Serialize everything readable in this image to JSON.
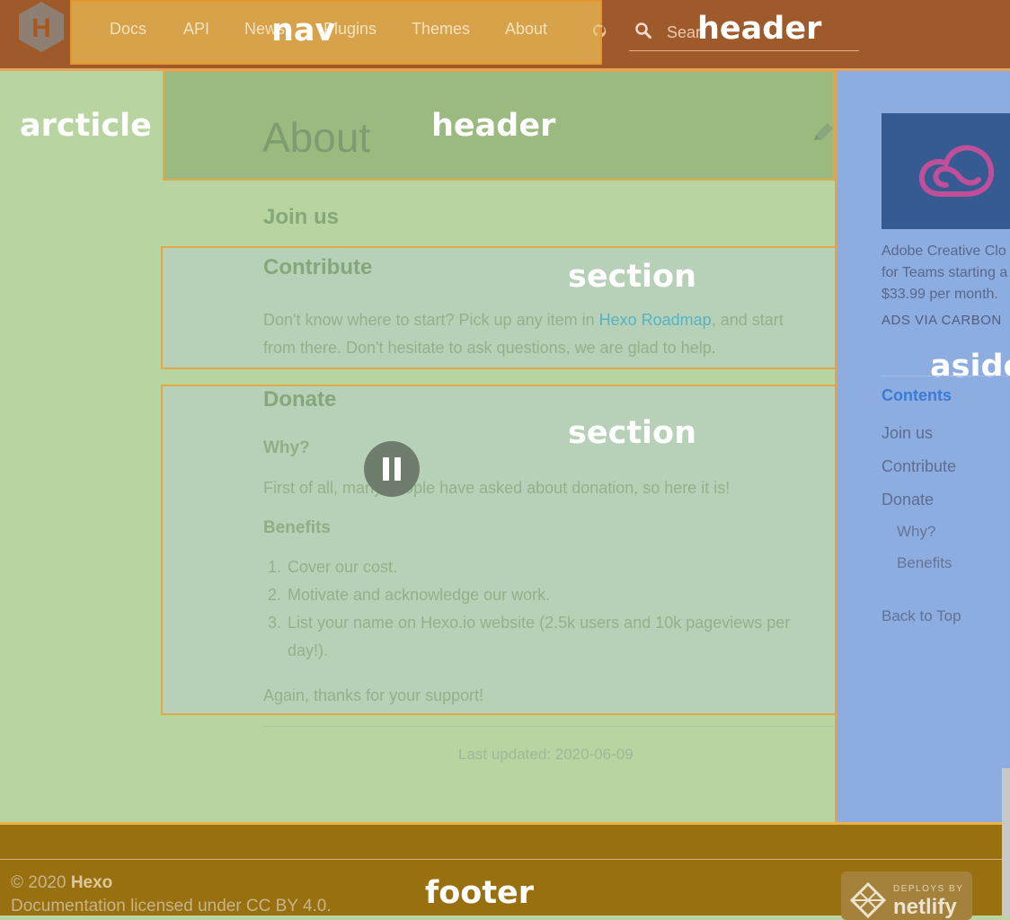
{
  "nav": {
    "label": "nav",
    "items": [
      {
        "label": "Docs"
      },
      {
        "label": "API"
      },
      {
        "label": "News"
      },
      {
        "label": "Plugins"
      },
      {
        "label": "Themes"
      },
      {
        "label": "About"
      }
    ]
  },
  "header": {
    "label": "header",
    "search_placeholder": "Sear",
    "logo_letter": "H"
  },
  "article": {
    "label": "arcticle",
    "header_label": "header",
    "title": "About",
    "join_us": "Join us",
    "contribute": {
      "label": "section",
      "heading": "Contribute",
      "text_before_link": "Don't know where to start? Pick up any item in ",
      "link": "Hexo Roadmap",
      "text_after_link": ", and start",
      "text_line2": "from there. Don't hesitate to ask questions, we are glad to help."
    },
    "donate": {
      "label": "section",
      "heading": "Donate",
      "why": "Why?",
      "why_text": "First of all, many people have asked about donation, so here it is!",
      "benefits": "Benefits",
      "list": [
        {
          "num": "1.",
          "text": "Cover our cost."
        },
        {
          "num": "2.",
          "text": "Motivate and acknowledge our work."
        },
        {
          "num": "3.",
          "text": "List your name on Hexo.io website (2.5k users and 10k pageviews per"
        }
      ],
      "list_continued": "day!).",
      "thanks": "Again, thanks for your support!"
    },
    "last_updated": "Last updated: 2020-06-09"
  },
  "aside": {
    "label": "aside",
    "ad_text": "Adobe Creative Clo\nfor Teams starting a\n$33.99 per month.",
    "ads_via": "ADS VIA CARBON",
    "toc_title": "Contents",
    "toc": [
      {
        "label": "Join us"
      },
      {
        "label": "Contribute"
      },
      {
        "label": "Donate"
      }
    ],
    "toc_sub": [
      {
        "label": "Why?"
      },
      {
        "label": "Benefits"
      }
    ],
    "back_to_top": "Back to Top"
  },
  "footer": {
    "label": "footer",
    "copyright_prefix": "© 2020 ",
    "copyright_brand": "Hexo",
    "license": "Documentation licensed under CC BY 4.0.",
    "netlify_deploys": "DEPLOYS BY",
    "netlify_name": "netlify"
  },
  "colors": {
    "header_bg": "#9e5a2a",
    "nav_bg": "#d8a24a",
    "article_bg": "#b8d4a0",
    "aside_bg": "#8dace0",
    "footer_bg": "#99700f",
    "link": "#56b3c3"
  },
  "icons": [
    "hexo-logo-icon",
    "github-icon",
    "search-icon",
    "edit-pencil-icon",
    "creative-cloud-icon",
    "pause-icon",
    "netlify-icon"
  ]
}
